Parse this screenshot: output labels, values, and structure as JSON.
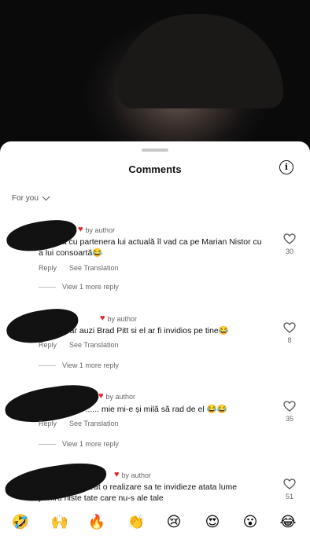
{
  "sheet": {
    "title": "Comments",
    "info_icon": "i",
    "sort_label": "For you"
  },
  "comments": [
    {
      "meta": "by author",
      "text": "Pe ăsta cu partenera lui actuală îl vad ca pe Marian Nistor cu a  lui consoartă😂",
      "reply": "Reply",
      "translate": "See Translation",
      "likes": "30",
      "view_replies": "View 1 more reply"
    },
    {
      "meta": "by author",
      "text": "Daca te-ar auzi Brad Pitt si el ar fi invidios pe tine😂",
      "reply": "Reply",
      "translate": "See Translation",
      "likes": "8",
      "view_replies": "View 1 more reply"
    },
    {
      "meta": "by author",
      "text": "Dragul de el ...... mie mi-e și milă să rad de el 😂😂",
      "reply": "Reply",
      "translate": "See Translation",
      "likes": "35",
      "view_replies": "View 1 more reply"
    },
    {
      "meta": "by author",
      "text": "Este cu adevarat o realizare sa te invidieze atata lume pentru niste tate care nu-s ale tale",
      "likes": "51"
    }
  ],
  "emojis": [
    "🤣",
    "🙌",
    "🔥",
    "👏",
    "😢",
    "😍",
    "😮",
    "😂"
  ]
}
